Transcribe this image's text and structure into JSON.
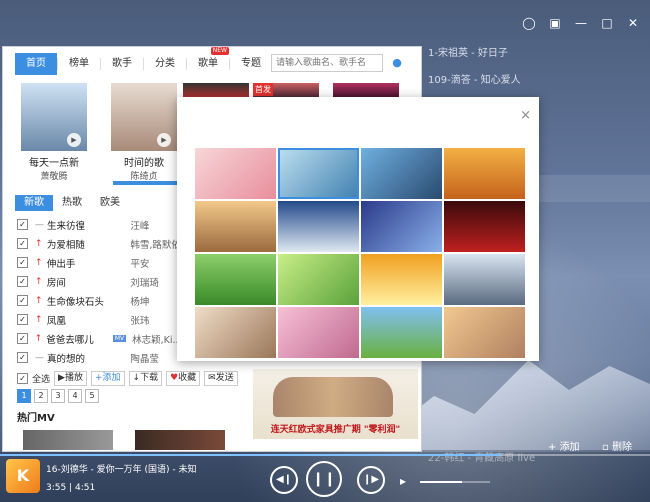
{
  "window": {
    "controls": [
      "skin-icon",
      "mini-mode-icon",
      "minimize-icon",
      "maximize-icon",
      "close-icon"
    ]
  },
  "playlist": {
    "items": [
      "1-宋祖英 - 好日子",
      "109-滴答 - 知心爱人",
      "",
      "",
      "",
      "",
      "",
      "",
      "",
      "",
      "",
      "",
      "",
      "",
      "",
      "22-韩红 - 青藏高原 live",
      ""
    ]
  },
  "store": {
    "nav": {
      "tabs": [
        "首页",
        "榜单",
        "歌手",
        "分类",
        "歌单",
        "专题"
      ],
      "selected": 0,
      "new_badge": "NEW",
      "search_placeholder": "请输入歌曲名、歌手名"
    },
    "featured": [
      {
        "title": "每天一点新",
        "artist": "萧敬腾"
      },
      {
        "title": "时间的歌",
        "artist": "陈绮贞"
      },
      {
        "title": "",
        "artist": ""
      },
      {
        "title": "",
        "artist": ""
      },
      {
        "title": "",
        "artist": ""
      }
    ],
    "featured_badge": "首发",
    "subtabs": [
      "新歌",
      "热歌",
      "欧美"
    ],
    "songs": [
      {
        "name": "生来彷徨",
        "artist": "汪峰",
        "up": false,
        "mv": false
      },
      {
        "name": "为爱相随",
        "artist": "韩雪,路默依",
        "up": true,
        "mv": false
      },
      {
        "name": "伸出手",
        "artist": "平安",
        "up": true,
        "mv": false
      },
      {
        "name": "房间",
        "artist": "刘瑞琦",
        "up": true,
        "mv": false
      },
      {
        "name": "生命像块石头",
        "artist": "杨坤",
        "up": true,
        "mv": false
      },
      {
        "name": "凤凰",
        "artist": "张玮",
        "up": true,
        "mv": false
      },
      {
        "name": "爸爸去哪儿",
        "artist": "林志颖,Ki...",
        "up": true,
        "mv": true
      },
      {
        "name": "真的想的",
        "artist": "陶晶莹",
        "up": false,
        "mv": false
      }
    ],
    "mv_badge": "MV",
    "actions": {
      "select_all": "全选",
      "play": "播放",
      "add": "添加",
      "download": "下载",
      "collect": "收藏",
      "send": "发送"
    },
    "pages": [
      "1",
      "2",
      "3",
      "4",
      "5"
    ],
    "current_page": 0,
    "hot_mv": "热门MV",
    "ad_text": "连天红欧式家具推广期 \"零利润\""
  },
  "skin_dialog": {
    "close": "×",
    "selected": 1,
    "thumbs": 16
  },
  "bottom": {
    "add_label": "添加",
    "delete_label": "删除"
  },
  "player": {
    "now_playing": "16-刘德华 - 爱你一万年 (国语) - 未知",
    "elapsed": "3:55",
    "total": "4:51",
    "progress": 0.77,
    "volume": 0.6
  }
}
